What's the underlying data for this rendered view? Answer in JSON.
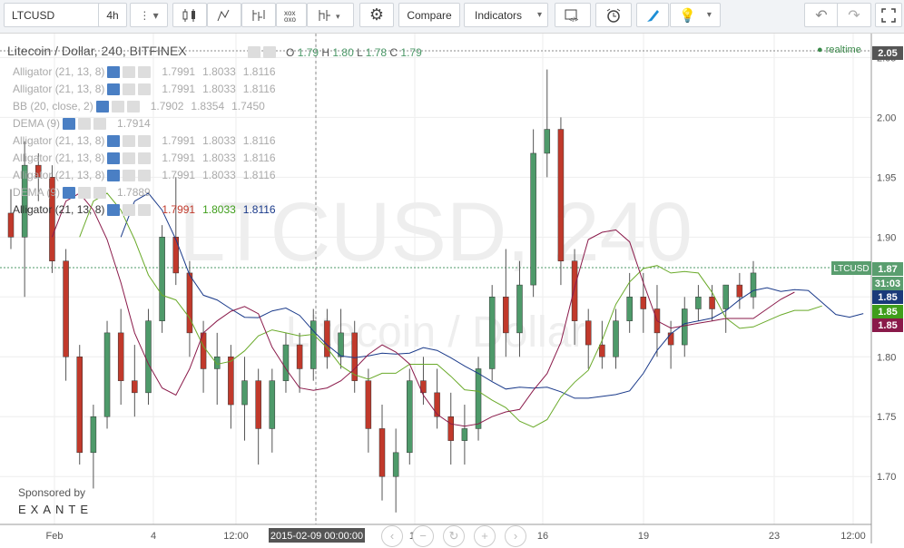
{
  "toolbar": {
    "symbol": "LTCUSD",
    "interval": "4h",
    "compare_label": "Compare",
    "indicators_label": "Indicators"
  },
  "legend": {
    "title": "Litecoin / Dollar, 240, BITFINEX",
    "ohlc": {
      "o_label": "O",
      "o": "1.79",
      "h_label": "H",
      "h": "1.80",
      "l_label": "L",
      "l": "1.78",
      "c_label": "C",
      "c": "1.79"
    },
    "realtime": "realtime",
    "studies": [
      {
        "name": "Alligator (21, 13, 8)",
        "v1": "1.7991",
        "v2": "1.8033",
        "v3": "1.8116"
      },
      {
        "name": "Alligator (21, 13, 8)",
        "v1": "1.7991",
        "v2": "1.8033",
        "v3": "1.8116"
      },
      {
        "name": "BB (20, close, 2)",
        "v1": "1.7902",
        "v2": "1.8354",
        "v3": "1.7450"
      },
      {
        "name": "DEMA (9)",
        "v1": "1.7914",
        "v2": "",
        "v3": ""
      },
      {
        "name": "Alligator (21, 13, 8)",
        "v1": "1.7991",
        "v2": "1.8033",
        "v3": "1.8116"
      },
      {
        "name": "Alligator (21, 13, 8)",
        "v1": "1.7991",
        "v2": "1.8033",
        "v3": "1.8116"
      },
      {
        "name": "Alligator (21, 13, 8)",
        "v1": "1.7991",
        "v2": "1.8033",
        "v3": "1.8116"
      },
      {
        "name": "DEMA (9)",
        "v1": "1.7889",
        "v2": "",
        "v3": ""
      },
      {
        "name": "Alligator (21, 13, 8)",
        "v1": "1.7991",
        "v2": "1.8033",
        "v3": "1.8116"
      }
    ]
  },
  "watermark": {
    "symbol": "LTCUSD, 240",
    "name": "Litecoin / Dollar"
  },
  "sponsor": {
    "label": "Sponsored by",
    "brand": "EXANTE"
  },
  "price_axis": {
    "ticks": [
      "2.05",
      "2.00",
      "1.95",
      "1.90",
      "1.85",
      "1.80",
      "1.75",
      "1.70"
    ],
    "labels": [
      {
        "text": "2.05",
        "bg": "#555555",
        "fg": "#ffffff"
      },
      {
        "text": "1.87",
        "bg": "#5a9e6f",
        "fg": "#ffffff"
      },
      {
        "text": "31:03",
        "bg": "#5a9e6f",
        "fg": "#ffffff"
      },
      {
        "text": "1.85",
        "bg": "#1a3a7a",
        "fg": "#ffffff"
      },
      {
        "text": "1.85",
        "bg": "#3f9e1b",
        "fg": "#ffffff"
      },
      {
        "text": "1.85",
        "bg": "#8a1a4a",
        "fg": "#ffffff"
      }
    ],
    "ltc_tag": "LTCUSD"
  },
  "time_axis": {
    "labels": [
      "Feb",
      "4",
      "12:00",
      "9",
      "12",
      "16",
      "19",
      "23",
      "12:00"
    ],
    "crosshair": "2015-02-09 00:00:00"
  },
  "colors": {
    "up": "#4e9a6a",
    "down": "#c1392b",
    "jaw": "#1a3a8a",
    "teeth": "#6aaa2a",
    "lips": "#8a1a4a",
    "grid": "#eeeeee",
    "crosshair": "#888888"
  },
  "chart_data": {
    "type": "candlestick",
    "title": "Litecoin / Dollar, 240, BITFINEX",
    "ylim": [
      1.66,
      2.07
    ],
    "x_ticks": [
      "Feb",
      "4",
      "12:00",
      "9",
      "12",
      "16",
      "19",
      "23",
      "12:00"
    ],
    "candles_ohlc": [
      [
        1.92,
        1.94,
        1.89,
        1.9
      ],
      [
        1.9,
        1.98,
        1.85,
        1.96
      ],
      [
        1.96,
        1.97,
        1.93,
        1.95
      ],
      [
        1.95,
        1.96,
        1.87,
        1.88
      ],
      [
        1.88,
        1.89,
        1.78,
        1.8
      ],
      [
        1.8,
        1.81,
        1.71,
        1.72
      ],
      [
        1.72,
        1.76,
        1.69,
        1.75
      ],
      [
        1.75,
        1.83,
        1.74,
        1.82
      ],
      [
        1.82,
        1.84,
        1.76,
        1.78
      ],
      [
        1.78,
        1.81,
        1.75,
        1.77
      ],
      [
        1.77,
        1.84,
        1.76,
        1.83
      ],
      [
        1.83,
        1.91,
        1.82,
        1.9
      ],
      [
        1.9,
        1.95,
        1.86,
        1.87
      ],
      [
        1.87,
        1.88,
        1.8,
        1.82
      ],
      [
        1.82,
        1.83,
        1.77,
        1.79
      ],
      [
        1.79,
        1.82,
        1.76,
        1.8
      ],
      [
        1.8,
        1.81,
        1.74,
        1.76
      ],
      [
        1.76,
        1.8,
        1.73,
        1.78
      ],
      [
        1.78,
        1.79,
        1.71,
        1.74
      ],
      [
        1.74,
        1.79,
        1.72,
        1.78
      ],
      [
        1.78,
        1.82,
        1.77,
        1.81
      ],
      [
        1.81,
        1.82,
        1.77,
        1.79
      ],
      [
        1.79,
        1.84,
        1.78,
        1.83
      ],
      [
        1.83,
        1.84,
        1.79,
        1.8
      ],
      [
        1.8,
        1.84,
        1.79,
        1.82
      ],
      [
        1.82,
        1.83,
        1.77,
        1.78
      ],
      [
        1.78,
        1.79,
        1.72,
        1.74
      ],
      [
        1.74,
        1.76,
        1.68,
        1.7
      ],
      [
        1.7,
        1.74,
        1.67,
        1.72
      ],
      [
        1.72,
        1.79,
        1.71,
        1.78
      ],
      [
        1.78,
        1.8,
        1.76,
        1.77
      ],
      [
        1.77,
        1.79,
        1.74,
        1.75
      ],
      [
        1.75,
        1.77,
        1.71,
        1.73
      ],
      [
        1.73,
        1.76,
        1.71,
        1.74
      ],
      [
        1.74,
        1.8,
        1.73,
        1.79
      ],
      [
        1.79,
        1.86,
        1.78,
        1.85
      ],
      [
        1.85,
        1.89,
        1.8,
        1.82
      ],
      [
        1.82,
        1.88,
        1.8,
        1.86
      ],
      [
        1.86,
        1.99,
        1.85,
        1.97
      ],
      [
        1.97,
        2.04,
        1.95,
        1.99
      ],
      [
        1.99,
        2.0,
        1.86,
        1.88
      ],
      [
        1.88,
        1.89,
        1.81,
        1.83
      ],
      [
        1.83,
        1.84,
        1.79,
        1.81
      ],
      [
        1.81,
        1.83,
        1.79,
        1.8
      ],
      [
        1.8,
        1.84,
        1.79,
        1.83
      ],
      [
        1.83,
        1.87,
        1.82,
        1.85
      ],
      [
        1.85,
        1.87,
        1.82,
        1.84
      ],
      [
        1.84,
        1.86,
        1.8,
        1.82
      ],
      [
        1.82,
        1.83,
        1.79,
        1.81
      ],
      [
        1.81,
        1.85,
        1.8,
        1.84
      ],
      [
        1.84,
        1.86,
        1.83,
        1.85
      ],
      [
        1.85,
        1.86,
        1.83,
        1.84
      ],
      [
        1.84,
        1.86,
        1.82,
        1.86
      ],
      [
        1.86,
        1.87,
        1.84,
        1.85
      ],
      [
        1.85,
        1.88,
        1.84,
        1.87
      ]
    ],
    "series": [
      {
        "name": "Alligator Jaw",
        "color": "#1a3a8a"
      },
      {
        "name": "Alligator Teeth",
        "color": "#6aaa2a"
      },
      {
        "name": "Alligator Lips",
        "color": "#8a1a4a"
      }
    ]
  }
}
